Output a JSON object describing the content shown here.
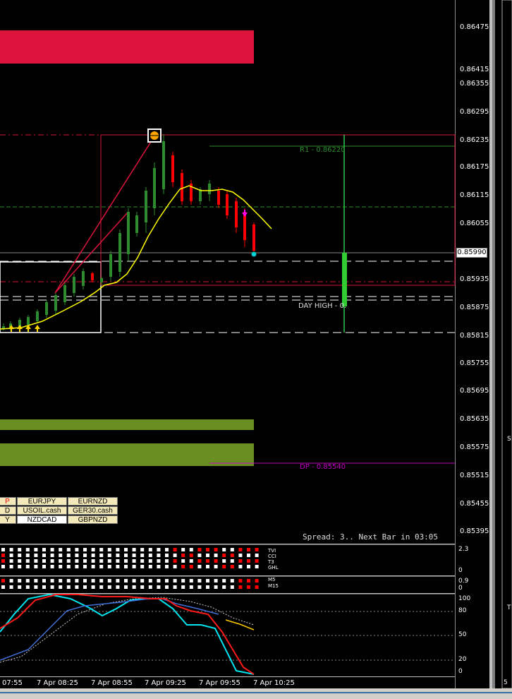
{
  "chart": {
    "price_axis": [
      "0.86475",
      "0.86415",
      "0.86355",
      "0.86295",
      "0.86235",
      "0.86175",
      "0.86115",
      "0.86055",
      "0.85990",
      "0.85935",
      "0.85875",
      "0.85815",
      "0.85755",
      "0.85695",
      "0.85635",
      "0.85575",
      "0.85515",
      "0.85455",
      "0.85395"
    ],
    "current_price": "0.85990",
    "r1_label": "R1 - 0.86220",
    "dp_label": "DP - 0.85540",
    "day_high_label": "DAY HIGH - 0.",
    "spread_text": "Spread: 3.. Next Bar in 03:05",
    "colors": {
      "bull": "#2e8b2e",
      "bear": "#ff0000",
      "ma": "#ffff00",
      "supply": "#dc143c",
      "demand": "#6b8e23"
    }
  },
  "symbols": [
    [
      "P",
      "EURJPY",
      "EURNZD"
    ],
    [
      "D",
      "USOIL.cash",
      "GER30.cash"
    ],
    [
      "Y",
      "NZDCAD",
      "GBPNZD"
    ]
  ],
  "indicator1": {
    "labels": [
      "TVI",
      "CCI",
      "T3",
      "GHL"
    ],
    "scale_top": "2.3",
    "scale_bottom": "0"
  },
  "indicator2": {
    "labels": [
      "M5",
      "M15"
    ],
    "scale_top": "0.9",
    "scale_bottom": "0"
  },
  "stochastic": {
    "levels": [
      "100",
      "80",
      "50",
      "20",
      "0"
    ]
  },
  "time_axis": [
    "07:55",
    "7 Apr 08:25",
    "7 Apr 08:55",
    "7 Apr 09:25",
    "7 Apr 09:55",
    "7 Apr 10:25"
  ],
  "right_edge": {
    "panel_label": "S",
    "panel_label2": "T",
    "bottom_digit": "5"
  }
}
